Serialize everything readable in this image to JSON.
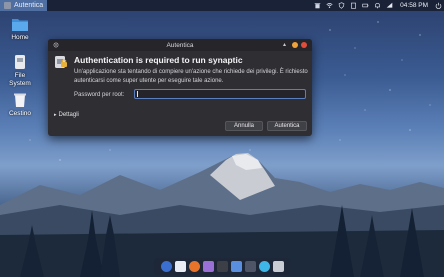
{
  "top_panel": {
    "active_app": "Autentica",
    "clock": "04:58 PM",
    "tray_icons": [
      "trash-icon",
      "wifi-icon",
      "shield-icon",
      "clipboard-icon",
      "battery-icon",
      "bell-icon",
      "network-icon",
      "power-icon"
    ]
  },
  "desktop": {
    "icons": [
      {
        "label": "Home",
        "icon": "folder-icon"
      },
      {
        "label": "File System",
        "icon": "drive-icon"
      },
      {
        "label": "Cestino",
        "icon": "trash-icon"
      }
    ]
  },
  "dialog": {
    "window_title": "Autentica",
    "headline": "Authentication is required to run synaptic",
    "description": "Un'applicazione sta tentando di compiere un'azione che richiede dei privilegi. È richiesto autenticarsi come super utente per eseguire tale azione.",
    "password_label": "Password per root:",
    "password_value": "",
    "details_label": "Dettagli",
    "cancel_label": "Annulla",
    "ok_label": "Autentica"
  },
  "dock": {
    "items": [
      "finder-icon",
      "files-icon",
      "software-icon",
      "photos-icon",
      "synaptic-icon",
      "terminal-icon",
      "desktop-icon",
      "browser-icon",
      "installer-icon"
    ]
  },
  "colors": {
    "panel_accent": "#4f6fa3",
    "dialog_bg": "#2e2e33",
    "input_focus": "#5a7fc0",
    "minimize_dot": "#f0a23a",
    "close_dot": "#e14d3a"
  }
}
